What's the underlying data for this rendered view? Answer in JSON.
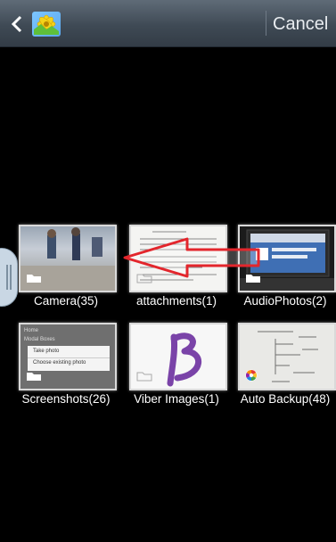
{
  "header": {
    "cancel_label": "Cancel",
    "back_icon": "chevron-left-icon",
    "app_icon": "gallery-app-icon"
  },
  "albums": [
    {
      "label": "Camera(35)",
      "icon": "folder-icon"
    },
    {
      "label": "attachments(1)",
      "icon": "folder-icon"
    },
    {
      "label": "AudioPhotos(2)",
      "icon": "folder-icon"
    },
    {
      "label": "Screenshots(26)",
      "icon": "folder-icon"
    },
    {
      "label": "Viber Images(1)",
      "icon": "folder-icon"
    },
    {
      "label": "Auto Backup(48)",
      "icon": "picasa-icon"
    }
  ],
  "screenshot_thumb": {
    "header": "Home",
    "subheader": "Modal Boxes",
    "option_1": "Take photo",
    "option_2": "Choose existing photo"
  },
  "colors": {
    "header_bg": "#404b56",
    "arrow": "#e3262c",
    "viber_letter": "#7a43a8"
  }
}
